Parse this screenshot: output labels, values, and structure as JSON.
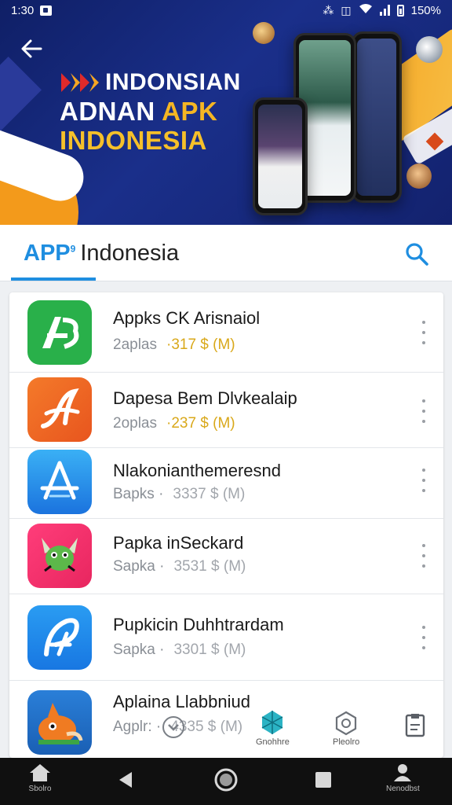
{
  "status_bar": {
    "time": "1:30",
    "battery": "150%"
  },
  "banner": {
    "title_line1": "INDONSIAN",
    "title_line2_white": "ADNAN",
    "title_line2_accent": "APK",
    "title_line3": "INDONESIA"
  },
  "tab": {
    "prefix": "APP",
    "prefix_sup": "9",
    "title": "Indonesia"
  },
  "apps": [
    {
      "name": "Appks CK Arisnaiol",
      "type": "2aplas",
      "size": "·317 $ (M)",
      "icon": "ab-icon",
      "highlight": true
    },
    {
      "name": "Dapesa Bem Dlvkealaip",
      "type": "2oplas",
      "size": "·237 $ (M)",
      "icon": "script-a-icon",
      "highlight": true
    },
    {
      "name": "Nlakonianthemeresnd",
      "type": "Bapks ·",
      "size": "3337 $ (M)",
      "icon": "app-store-icon",
      "highlight": false
    },
    {
      "name": "Papka inSeckard",
      "type": "Sapka ·",
      "size": "3531 $ (M)",
      "icon": "dragon-icon",
      "highlight": false
    },
    {
      "name": "Pupkicin Duhhtrardam",
      "type": "Sapka ·",
      "size": "3301 $ (M)",
      "icon": "pen-a-icon",
      "highlight": false
    },
    {
      "name": "Aplaina Llabbniud",
      "type": "Agplr: ·",
      "size": "4335 $ (M)",
      "icon": "fox-icon",
      "highlight": false
    }
  ],
  "overlay_labels": {
    "games": "Gnohhre",
    "profile": "Pleolro"
  },
  "bottom_nav": {
    "home": "Sbolro",
    "account": "Nenodbst"
  },
  "colors": {
    "accent_blue": "#1f8ee0",
    "banner_blue": "#13226e",
    "gold": "#f5c02a"
  }
}
